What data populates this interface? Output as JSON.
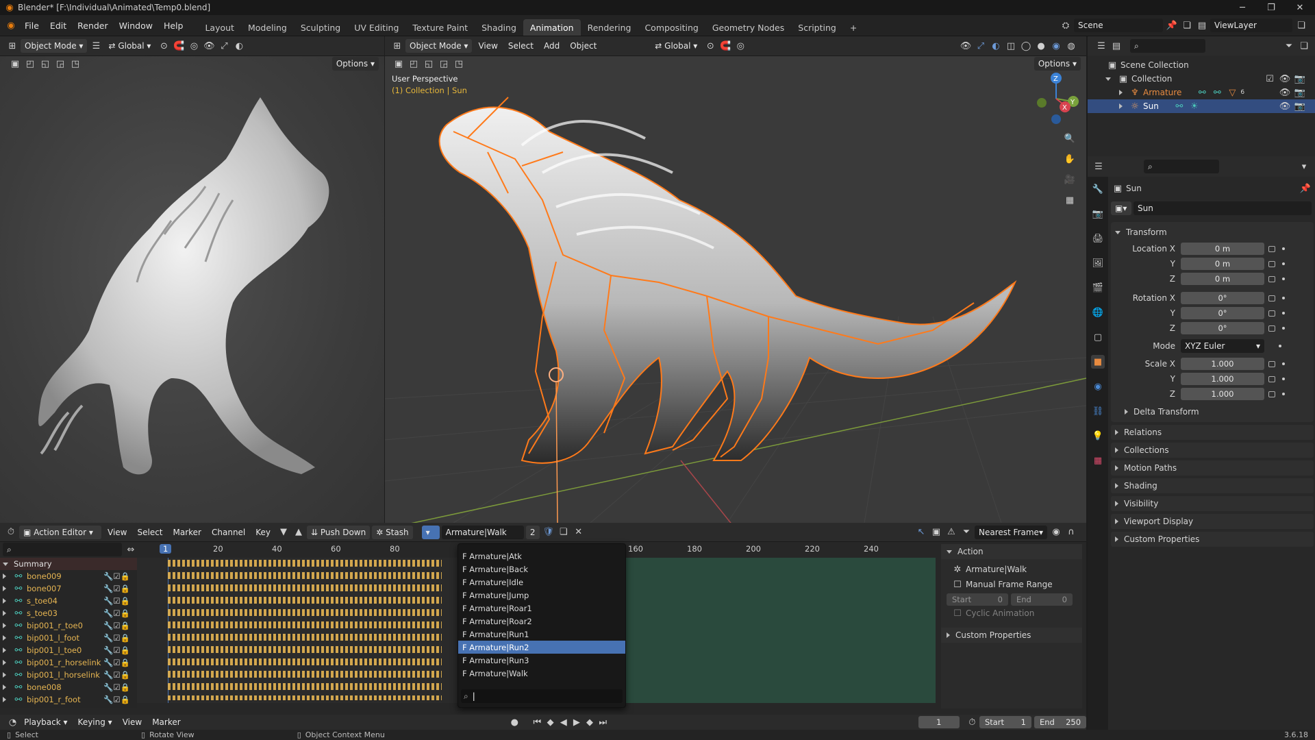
{
  "title_bar": {
    "title": "Blender* [F:\\Individual\\Animated\\Temp0.blend]"
  },
  "menu": {
    "items": [
      "File",
      "Edit",
      "Render",
      "Window",
      "Help"
    ],
    "workspaces": [
      "Layout",
      "Modeling",
      "Sculpting",
      "UV Editing",
      "Texture Paint",
      "Shading",
      "Animation",
      "Rendering",
      "Compositing",
      "Geometry Nodes",
      "Scripting"
    ],
    "active_workspace": "Animation",
    "add_tab": "+",
    "scene": "Scene",
    "view_layer": "ViewLayer"
  },
  "viewport_left": {
    "mode": "Object Mode",
    "orientation": "Global",
    "options": "Options"
  },
  "viewport_main": {
    "mode": "Object Mode",
    "menus": [
      "View",
      "Select",
      "Add",
      "Object"
    ],
    "orientation": "Global",
    "options": "Options",
    "overlay_title": "User Perspective",
    "overlay_sub": "(1) Collection | Sun",
    "gizmo": {
      "x": "X",
      "y": "Y",
      "z": "Z"
    }
  },
  "outliner": {
    "root": "Scene Collection",
    "collection": "Collection",
    "items": [
      {
        "name": "Armature",
        "count": "6"
      },
      {
        "name": "Sun"
      }
    ]
  },
  "properties": {
    "object_name": "Sun",
    "data_name": "Sun",
    "transform_label": "Transform",
    "location": {
      "label": "Location X",
      "x": "0 m",
      "y": "0 m",
      "z": "0 m"
    },
    "rotation": {
      "label": "Rotation X",
      "x": "0°",
      "y": "0°",
      "z": "0°"
    },
    "mode_label": "Mode",
    "mode_value": "XYZ Euler",
    "scale": {
      "label": "Scale X",
      "x": "1.000",
      "y": "1.000",
      "z": "1.000"
    },
    "axis_y": "Y",
    "axis_z": "Z",
    "sections": [
      "Delta Transform",
      "Relations",
      "Collections",
      "Motion Paths",
      "Shading",
      "Visibility",
      "Viewport Display",
      "Custom Properties"
    ]
  },
  "action_editor": {
    "editor_name": "Action Editor",
    "menus": [
      "View",
      "Select",
      "Marker",
      "Channel",
      "Key"
    ],
    "push_down": "Push Down",
    "stash": "Stash",
    "action": "Armature|Walk",
    "users": "2",
    "snap": "Nearest Frame",
    "current_frame": "1",
    "frame_ticks": [
      "20",
      "40",
      "60",
      "80",
      "160",
      "180",
      "200",
      "220",
      "240"
    ],
    "summary": "Summary",
    "channels": [
      "bone009",
      "bone007",
      "s_toe04",
      "s_toe03",
      "bip001_r_toe0",
      "bip001_l_foot",
      "bip001_l_toe0",
      "bip001_r_horselink",
      "bip001_l_horselink",
      "bone008",
      "bip001_r_foot"
    ],
    "dropdown_items": [
      "F Armature|Atk",
      "F Armature|Back",
      "F Armature|Idle",
      "F Armature|Jump",
      "F Armature|Roar1",
      "F Armature|Roar2",
      "F Armature|Run1",
      "F Armature|Run2",
      "F Armature|Run3",
      "F Armature|Walk"
    ],
    "dropdown_selected": "F Armature|Run2",
    "side_panel": {
      "title": "Action",
      "action_name": "Armature|Walk",
      "manual_range": "Manual Frame Range",
      "start_label": "Start",
      "start_val": "0",
      "end_label": "End",
      "end_val": "0",
      "cyclic": "Cyclic Animation",
      "custom_props": "Custom Properties"
    }
  },
  "timeline": {
    "menus": [
      "Playback",
      "Keying",
      "View",
      "Marker"
    ],
    "frame": "1",
    "start_label": "Start",
    "start": "1",
    "end_label": "End",
    "end": "250"
  },
  "status_bar": {
    "select": "Select",
    "rotate": "Rotate View",
    "context": "Object Context Menu",
    "version": "3.6.18"
  },
  "colors": {
    "accent": "#4772b3",
    "selection_orange": "#ff7a1a",
    "keyframe": "#e6b552",
    "active_range": "#2a4a3d"
  }
}
